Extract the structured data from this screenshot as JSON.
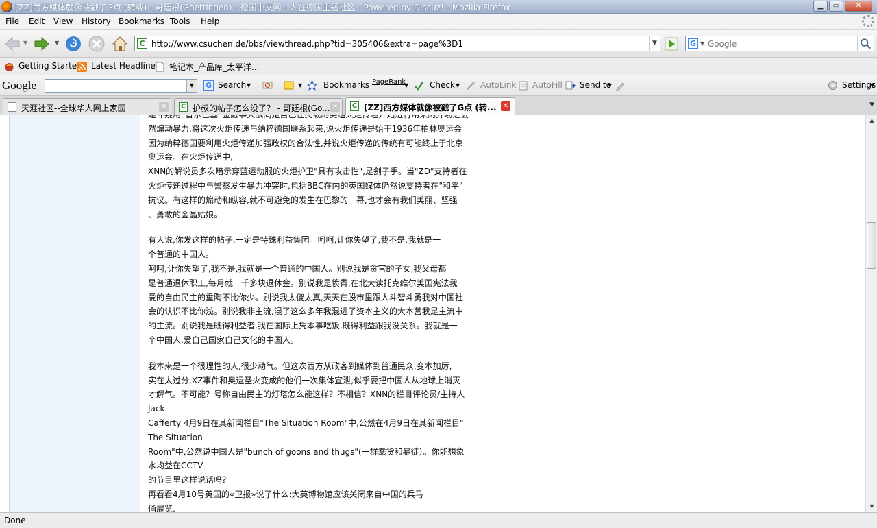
{
  "window": {
    "title": "[ZZ]西方媒体就像被戳了G点 (转载) - 哥廷根(Goettingen) - 德国中文网 - 人在德国主题社区 - Powered by Discuz! - Mozilla Firefox"
  },
  "menu": [
    "File",
    "Edit",
    "View",
    "History",
    "Bookmarks",
    "Tools",
    "Help"
  ],
  "nav": {
    "url": "http://www.csuchen.de/bbs/viewthread.php?tid=305406&extra=page%3D1",
    "search_placeholder": "Google"
  },
  "bookmarks": [
    "Getting Started",
    "Latest Headlines",
    "笔记本_产品库_太平洋..."
  ],
  "google_toolbar": {
    "logo": "Google",
    "search": "Search",
    "bookmarks": "Bookmarks",
    "pagerank": "PageRank",
    "check": "Check",
    "autolink": "AutoLink",
    "autofill": "AutoFill",
    "sendto": "Send to",
    "settings": "Settings"
  },
  "tabs": [
    {
      "title": "天涯社区--全球华人网上家园"
    },
    {
      "title": "护叔的帖子怎么没了？ - 哥廷根(Go..."
    },
    {
      "title": "[ZZ]西方媒体就像被戳了G点 (转..."
    }
  ],
  "post": {
    "lines": [
      "是怀疑用“音乐巴塞”金融事大战同是自己在民载的奥运火炬传递开始进行用来的开场之会",
      "然煽动暴力,将这次火炬传递与纳粹德国联系起来,说火炬传递是始于1936年柏林奥运会",
      "因为纳粹德国要利用火炬传递加强政权的合法性,并说火炬传递的传统有可能终止于北京",
      "奥运会。在火炬传递中,",
      "XNN的解说员多次暗示穿蓝运动服的火炬护卫\"具有攻击性\",是刽子手。当\"ZD\"支持者在",
      "火炬传递过程中与警察发生暴力冲突时,包括BBC在内的英国媒体仍然说支持者在\"和平\"",
      "抗议。有这样的煽动和纵容,就不可避免的发生在巴黎的一幕,也才会有我们美丽、坚强",
      "、勇敢的金晶姑娘。",
      "",
      "有人说,你发这样的帖子,一定是特殊利益集团。呵呵,让你失望了,我不是,我就是一",
      "个普通的中国人。",
      "呵呵,让你失望了,我不是,我就是一个普通的中国人。别说我是贪官的子女,我父母都",
      "是普通退休职工,每月就一千多块退休金。别说我是愤青,在北大读托克维尔美国宪法我",
      "爱的自由民主的重陶不比你少。别说我太傻太真,天天在股市里跟人斗智斗勇我对中国社",
      "会的认识不比你浅。别说我非主流,混了这么多年我混进了资本主义的大本营我是主流中",
      "的主流。别说我是既得利益者,我在国际上凭本事吃饭,既得利益跟我没关系。我就是一",
      "个中国人,爱自己国家自己文化的中国人。",
      "",
      "我本来是一个很理性的人,很少动气。但这次西方从政客到媒体到普通民众,变本加厉,",
      "实在太过分,XZ事件和奥运圣火变成的他们一次集体宣泄,似乎要把中国人从地球上消灭",
      "才解气。不可能？号称自由民主的灯塔怎么能这样？不相信？XNN的栏目评论员/主持人",
      "Jack",
      "Cafferty 4月9日在其新闻栏目\"The Situation Room\"中,公然在4月9日在其新闻栏目\"",
      "The Situation",
      "Room\"中,公然说中国人是\"bunch of goons and thugs\"(一群蠢货和暴徒）。你能想象",
      "水均益在CCTV",
      "的节目里这样说话吗？",
      "再看看4月10号英国的«卫报»说了什么:大英博物馆应该关闭来自中国的兵马",
      "俑展览,"
    ]
  },
  "status": "Done"
}
